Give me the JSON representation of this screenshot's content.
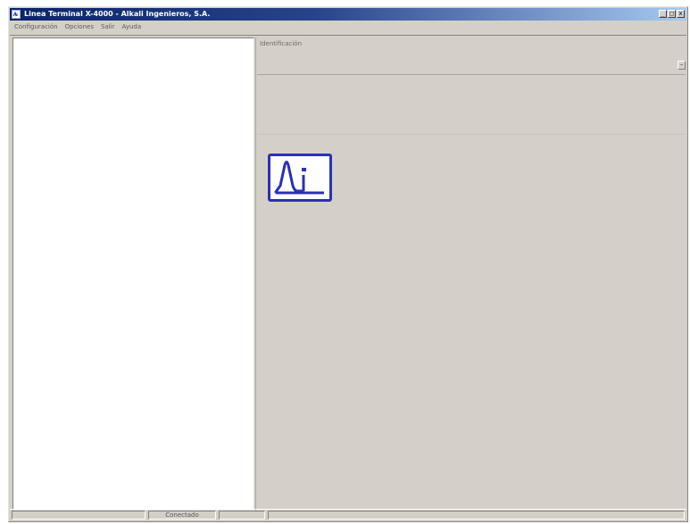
{
  "window": {
    "title": "Linea Terminal X-4000 - Alkali Ingenieros, S.A.",
    "app_icon": "app-icon",
    "controls": {
      "minimize": "_",
      "maximize": "□",
      "close": "x"
    }
  },
  "menu": {
    "items": [
      {
        "label": "Configuración"
      },
      {
        "label": "Opciones"
      },
      {
        "label": "Salir"
      },
      {
        "label": "Ayuda"
      }
    ]
  },
  "identification": {
    "label": "Identificación",
    "scroll_icon": "minus-icon"
  },
  "logo": {
    "icon": "ai-logo-icon",
    "color": "#2a30b8"
  },
  "status": {
    "cells": [
      {
        "text": ""
      },
      {
        "text": "Conectado"
      },
      {
        "text": ""
      },
      {
        "text": ""
      }
    ]
  }
}
